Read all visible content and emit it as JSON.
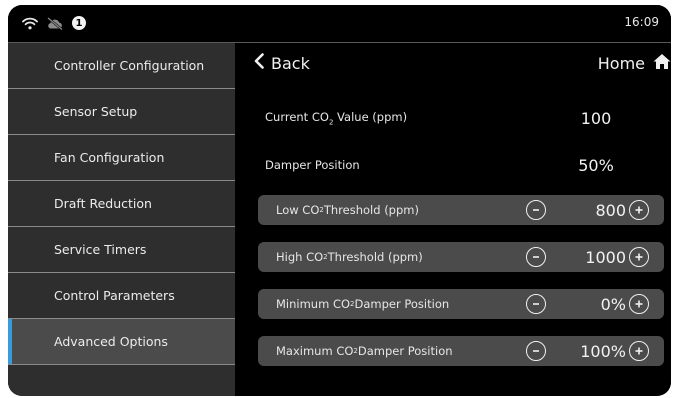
{
  "status": {
    "notification_count": "1",
    "time": "16:09",
    "icons": [
      "wifi-icon",
      "cloud-off-icon"
    ]
  },
  "sidebar": {
    "items": [
      {
        "label": "Controller Configuration"
      },
      {
        "label": "Sensor Setup"
      },
      {
        "label": "Fan Configuration"
      },
      {
        "label": "Draft Reduction"
      },
      {
        "label": "Service Timers"
      },
      {
        "label": "Control Parameters"
      },
      {
        "label": "Advanced Options",
        "active": true
      }
    ]
  },
  "header": {
    "back_label": "Back",
    "home_label": "Home"
  },
  "readings": {
    "current_co2": {
      "label_prefix": "Current CO",
      "label_sub": "2",
      "label_suffix": " Value (ppm)",
      "value": "100"
    },
    "damper_position": {
      "label": "Damper Position",
      "value": "50%"
    }
  },
  "settings": {
    "low_co2": {
      "label_prefix": "Low CO",
      "label_sub": "2",
      "label_suffix": " Threshold (ppm)",
      "value": "800"
    },
    "high_co2": {
      "label_prefix": "High CO",
      "label_sub": "2",
      "label_suffix": " Threshold (ppm)",
      "value": "1000"
    },
    "min_damper": {
      "label_prefix": "Minimum CO",
      "label_sub": "2",
      "label_suffix": " Damper Position",
      "value": "0%"
    },
    "max_damper": {
      "label_prefix": "Maximum CO",
      "label_sub": "2",
      "label_suffix": " Damper Position",
      "value": "100%"
    }
  },
  "colors": {
    "sidebar_bg": "#2e2e2e",
    "active_item_bg": "#4b4b4b",
    "active_indicator": "#3a9bdc",
    "row_bg": "#4b4b4b"
  }
}
